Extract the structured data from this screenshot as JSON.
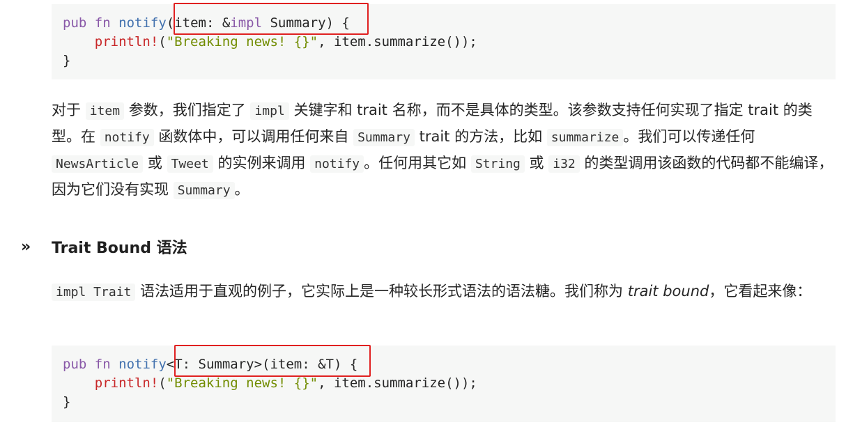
{
  "code1": {
    "lines": [
      [
        {
          "t": "pub",
          "c": "kw"
        },
        {
          "t": " "
        },
        {
          "t": "fn",
          "c": "kw"
        },
        {
          "t": " "
        },
        {
          "t": "notify",
          "c": "fn"
        },
        {
          "t": "(item: &"
        },
        {
          "t": "impl",
          "c": "kw"
        },
        {
          "t": " Summary) {"
        }
      ],
      [
        {
          "t": "    "
        },
        {
          "t": "println!",
          "c": "mac"
        },
        {
          "t": "("
        },
        {
          "t": "\"Breaking news! {}\"",
          "c": "str"
        },
        {
          "t": ", item.summarize());"
        }
      ],
      [
        {
          "t": "}"
        }
      ]
    ]
  },
  "para1": [
    {
      "t": "对于 "
    },
    {
      "code": "item"
    },
    {
      "t": " 参数，我们指定了 "
    },
    {
      "code": "impl"
    },
    {
      "t": " 关键字和 trait 名称，而不是具体的类型。该参数支持任何实现了指定 trait 的类型。在 "
    },
    {
      "code": "notify"
    },
    {
      "t": " 函数体中，可以调用任何来自 "
    },
    {
      "code": "Summary"
    },
    {
      "t": " trait 的方法，比如 "
    },
    {
      "code": "summarize"
    },
    {
      "t": "。我们可以传递任何 "
    },
    {
      "code": "NewsArticle"
    },
    {
      "t": " 或 "
    },
    {
      "code": "Tweet"
    },
    {
      "t": " 的实例来调用 "
    },
    {
      "code": "notify"
    },
    {
      "t": "。任何用其它如 "
    },
    {
      "code": "String"
    },
    {
      "t": " 或 "
    },
    {
      "code": "i32"
    },
    {
      "t": " 的类型调用该函数的代码都不能编译，因为它们没有实现 "
    },
    {
      "code": "Summary"
    },
    {
      "t": "。"
    }
  ],
  "heading": {
    "anchor": "»",
    "text": "Trait Bound 语法"
  },
  "para2": [
    {
      "code": "impl Trait"
    },
    {
      "t": " 语法适用于直观的例子，它实际上是一种较长形式语法的语法糖。我们称为 "
    },
    {
      "em": "trait bound"
    },
    {
      "t": "，它看起来像："
    }
  ],
  "code2": {
    "lines": [
      [
        {
          "t": "pub",
          "c": "kw"
        },
        {
          "t": " "
        },
        {
          "t": "fn",
          "c": "kw"
        },
        {
          "t": " "
        },
        {
          "t": "notify",
          "c": "fn"
        },
        {
          "t": "<T: Summary>(item: &T) {"
        }
      ],
      [
        {
          "t": "    "
        },
        {
          "t": "println!",
          "c": "mac"
        },
        {
          "t": "("
        },
        {
          "t": "\"Breaking news! {}\"",
          "c": "str"
        },
        {
          "t": ", item.summarize());"
        }
      ],
      [
        {
          "t": "}"
        }
      ]
    ]
  },
  "colors": {
    "keyword": "#8959a8",
    "function": "#4271ae",
    "macro": "#c82829",
    "string": "#718c00",
    "highlight": "#e02020",
    "code_bg": "#f6f7f6"
  }
}
